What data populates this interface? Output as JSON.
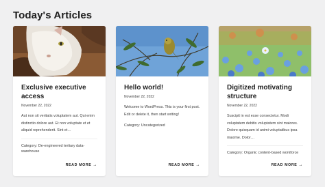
{
  "section": {
    "title": "Today's Articles"
  },
  "articles": [
    {
      "image": "cat-photo",
      "title": "Exclusive executive access",
      "date": "November 22, 2022",
      "excerpt": "Aut non sit veritatis voluptatem aut. Qui enim distinctio dolore aut. Et non voluptate et et aliquid reprehenderit. Sint et…",
      "category_label": "Category:",
      "category": "De-engineered tertiary data-warehouse",
      "read_more": "READ MORE"
    },
    {
      "image": "bird-photo",
      "title": "Hello world!",
      "date": "November 22, 2022",
      "excerpt": "Welcome to WordPress. This is your first post. Edit or delete it, then start writing!",
      "category_label": "Category:",
      "category": "Uncategorized",
      "read_more": "READ MORE"
    },
    {
      "image": "flowers-photo",
      "title": "Digitized motivating structure",
      "date": "November 22, 2022",
      "excerpt": "Suscipit in est esse consectetur. Modi voluptatem debitis voluptatem sint maiores. Dolore quisquam id animi voluptatibus ipsa maxime. Dolor…",
      "category_label": "Category:",
      "category": "Organic content-based workforce",
      "read_more": "READ MORE"
    }
  ]
}
